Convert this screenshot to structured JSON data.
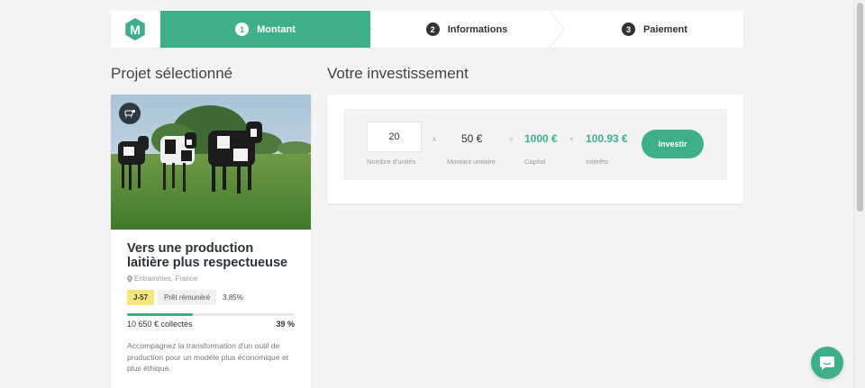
{
  "stepper": {
    "logo_letter": "M",
    "steps": [
      {
        "num": "1",
        "label": "Montant"
      },
      {
        "num": "2",
        "label": "Informations"
      },
      {
        "num": "3",
        "label": "Paiement"
      }
    ],
    "active_step": 1
  },
  "project": {
    "section_title": "Projet sélectionné",
    "category_icon": "cow-icon",
    "title": "Vers une production laitière plus respectueuse",
    "location": "Entrammes, France",
    "days_left": "J-57",
    "loan_type": "Prêt rémunéré",
    "rate": "3,85%",
    "progress_fraction": 0.39,
    "collected": "10 650 € collectés",
    "percent": "39 %",
    "description": "Accompagnez la transformation d'un outil de production pour un modèle plus économique et plus éthique."
  },
  "investment": {
    "section_title": "Votre investissement",
    "units_value": "20",
    "units_label": "Nombre d'unités",
    "op_times": "x",
    "unit_price": "50 €",
    "unit_price_label": "Montant unitaire",
    "op_equals": "=",
    "capital": "1000 €",
    "capital_label": "Capital",
    "op_plus": "+",
    "interest": "100.93 €",
    "interest_label": "Intérêts",
    "invest_button": "Investir"
  },
  "colors": {
    "accent": "#3db08a",
    "tag_yellow": "#f7e67a"
  }
}
